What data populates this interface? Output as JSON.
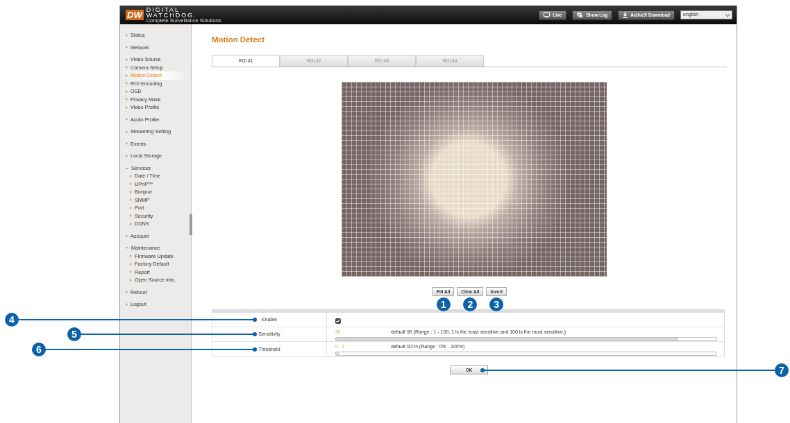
{
  "header": {
    "logo_mark": "DW",
    "logo_name_top": "DIGITAL",
    "logo_name_bottom": "WATCHDOG.",
    "logo_tagline": "Complete Surveillance Solutions",
    "buttons": [
      {
        "label": "Live",
        "kind": "monitor"
      },
      {
        "label": "Show Log",
        "kind": "window"
      },
      {
        "label": "ActiveX Download",
        "kind": "download"
      }
    ],
    "language": "english"
  },
  "sidebar": {
    "sections": [
      {
        "items": [
          {
            "label": "Status",
            "selected": false
          }
        ]
      },
      {
        "items": [
          {
            "label": "Network",
            "selected": false
          }
        ]
      },
      {
        "items": [
          {
            "label": "Video Source",
            "selected": false
          },
          {
            "label": "Camera Setup",
            "selected": false
          },
          {
            "label": "Motion Detect",
            "selected": true
          },
          {
            "label": "ROI Encoding",
            "selected": false
          },
          {
            "label": "OSD",
            "selected": false
          },
          {
            "label": "Privacy Mask",
            "selected": false
          },
          {
            "label": "Video Profile",
            "selected": false
          }
        ]
      },
      {
        "items": [
          {
            "label": "Audio Profile",
            "selected": false
          }
        ]
      },
      {
        "items": [
          {
            "label": "Streaming Setting",
            "selected": false
          }
        ]
      },
      {
        "items": [
          {
            "label": "Events",
            "selected": false
          }
        ]
      },
      {
        "items": [
          {
            "label": "Local Storage",
            "selected": false
          }
        ]
      },
      {
        "items": [
          {
            "label": "Services",
            "selected": false,
            "expanded": true,
            "children": [
              {
                "label": "Date / Time",
                "selected": false
              },
              {
                "label": "UPnP™",
                "selected": false
              },
              {
                "label": "Bonjour",
                "selected": false
              },
              {
                "label": "SNMP",
                "selected": false
              },
              {
                "label": "Port",
                "selected": false
              },
              {
                "label": "Security",
                "selected": false
              },
              {
                "label": "DDNS",
                "selected": false
              }
            ]
          }
        ]
      },
      {
        "items": [
          {
            "label": "Account",
            "selected": false
          }
        ]
      },
      {
        "items": [
          {
            "label": "Maintenance",
            "selected": false,
            "expanded": true,
            "children": [
              {
                "label": "Firmware Update",
                "selected": false
              },
              {
                "label": "Factory Default",
                "selected": false
              },
              {
                "label": "Report",
                "selected": false
              },
              {
                "label": "Open Source Info.",
                "selected": false
              }
            ]
          }
        ]
      },
      {
        "items": [
          {
            "label": "Reboot",
            "selected": false
          }
        ]
      },
      {
        "items": [
          {
            "label": "Logout",
            "selected": false
          }
        ]
      }
    ]
  },
  "title": "Motion Detect",
  "tabs": [
    {
      "label": "ROI #1",
      "selected": true
    },
    {
      "label": "ROI #2",
      "selected": false
    },
    {
      "label": "ROI #3",
      "selected": false
    },
    {
      "label": "ROI #4",
      "selected": false
    }
  ],
  "grid_buttons": [
    {
      "label": "Fill All",
      "callout": "1"
    },
    {
      "label": "Clear All",
      "callout": "2"
    },
    {
      "label": "Invert",
      "callout": "3"
    }
  ],
  "settings": [
    {
      "kind": "checkbox",
      "label": "Enable",
      "checked": true,
      "callout": "4"
    },
    {
      "kind": "slider",
      "label": "Sensitivity",
      "reading": "90",
      "note": "default 90 (Range : 1 - 100, 1 is the least sensitive and 100 is the most sensitive.)",
      "level": 0.9,
      "callout": "5"
    },
    {
      "kind": "slider",
      "label": "Threshold",
      "reading": "0 - 1",
      "note": "default 0/1% (Range : 0% - 100%)",
      "level": 0.01,
      "callout": "6"
    }
  ],
  "ok_button": {
    "label": "OK",
    "callout": "7"
  }
}
